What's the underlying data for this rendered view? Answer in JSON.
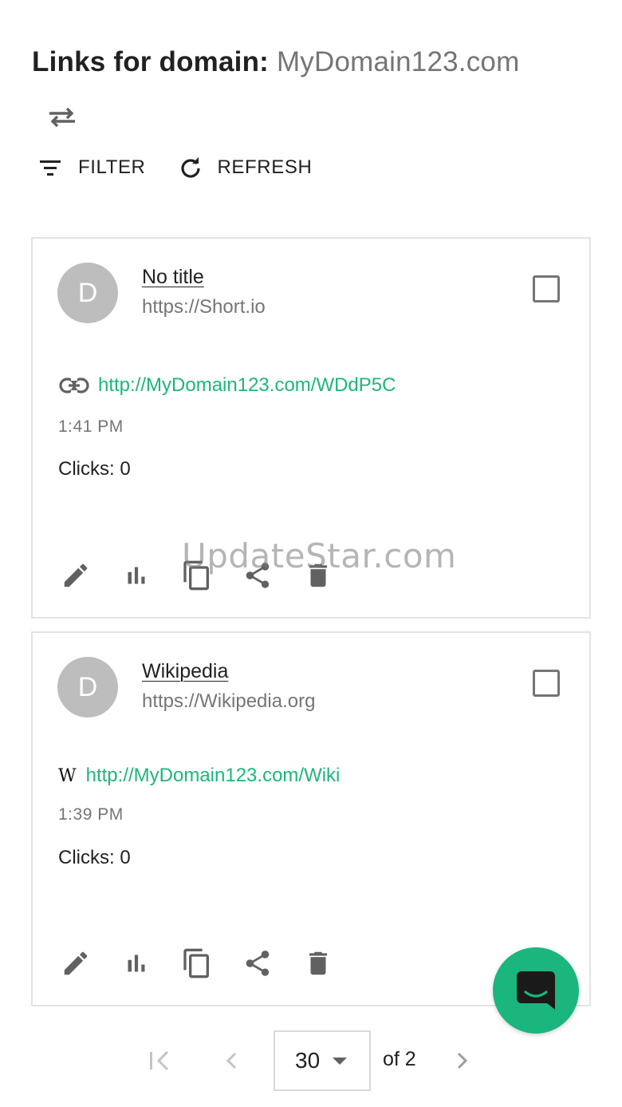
{
  "header": {
    "title_prefix": "Links for domain: ",
    "domain": "MyDomain123.com"
  },
  "toolbar": {
    "filter_label": "FILTER",
    "refresh_label": "REFRESH"
  },
  "links": [
    {
      "avatar_letter": "D",
      "title": "No title",
      "original_url": "https://Short.io",
      "short_url": "http://MyDomain123.com/WDdP5C",
      "favicon": "link-icon",
      "time": "1:41 PM",
      "clicks": "Clicks: 0"
    },
    {
      "avatar_letter": "D",
      "title": "Wikipedia",
      "original_url": "https://Wikipedia.org",
      "short_url": "http://MyDomain123.com/Wiki",
      "favicon": "wikipedia-icon",
      "favicon_glyph": "W",
      "time": "1:39 PM",
      "clicks": "Clicks: 0"
    }
  ],
  "watermark": "UpdateStar.com",
  "pagination": {
    "page_size": "30",
    "of_pages": "of 2"
  },
  "colors": {
    "accent": "#1db67a",
    "fab": "#1ab67e",
    "icon": "#616161",
    "muted": "#757575"
  }
}
